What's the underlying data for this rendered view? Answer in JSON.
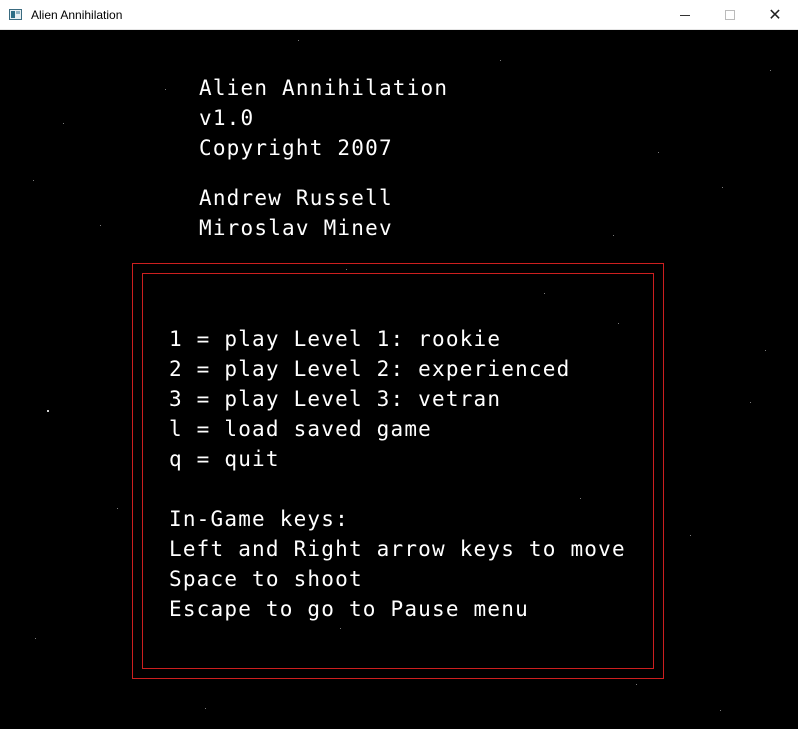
{
  "window": {
    "title": "Alien Annihilation",
    "minimize_label": "minimize",
    "maximize_label": "maximize",
    "close_label": "close"
  },
  "header": {
    "title": "Alien Annihilation",
    "version": "v1.0",
    "copyright": "Copyright 2007",
    "author_1": "Andrew Russell",
    "author_2": "Miroslav Minev"
  },
  "menu": {
    "option_1": "1 = play Level 1: rookie",
    "option_2": "2 = play Level 2: experienced",
    "option_3": "3 = play Level 3: vetran",
    "option_load": "l = load saved game",
    "option_quit": "q = quit"
  },
  "keys": {
    "heading": "In-Game keys:",
    "move": "Left and Right arrow keys to move",
    "shoot": "Space to shoot",
    "pause": "Escape to go to Pause menu"
  },
  "colors": {
    "background": "#000000",
    "text": "#ffffff",
    "border": "#cc1f1f"
  }
}
